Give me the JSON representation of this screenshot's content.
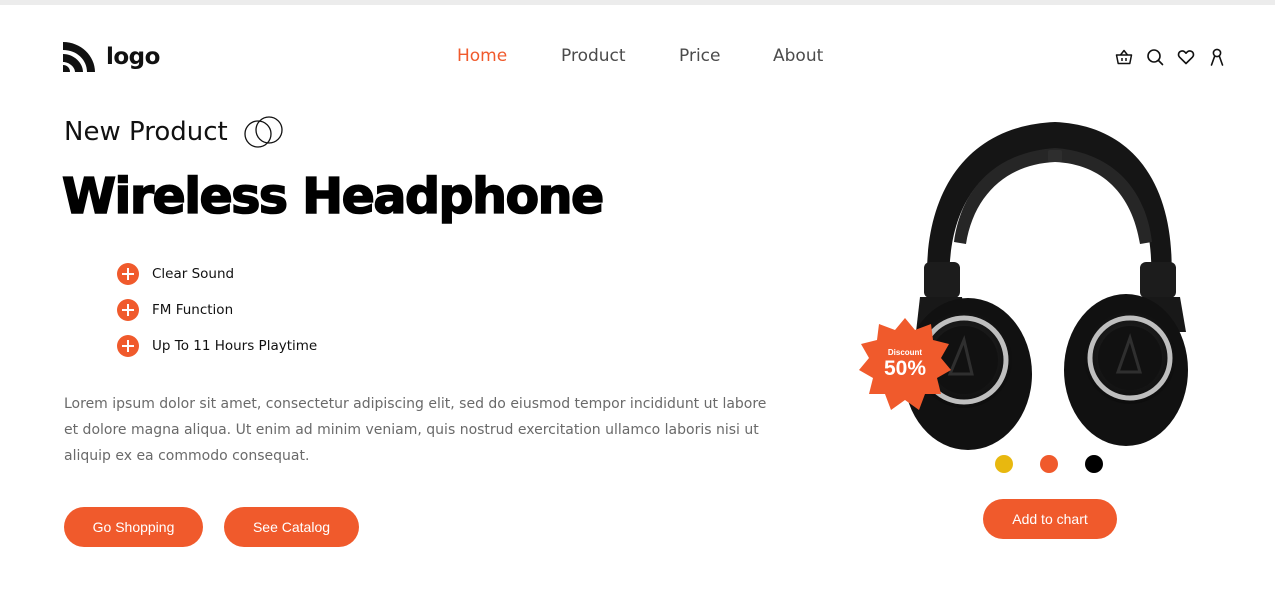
{
  "brand": {
    "logo_text": "logo"
  },
  "nav": {
    "items": [
      {
        "label": "Home",
        "active": true
      },
      {
        "label": "Product",
        "active": false
      },
      {
        "label": "Price",
        "active": false
      },
      {
        "label": "About",
        "active": false
      }
    ]
  },
  "header_icons": [
    "basket-icon",
    "search-icon",
    "heart-icon",
    "user-icon"
  ],
  "hero": {
    "eyebrow": "New Product",
    "title": "Wireless Headphone",
    "features": [
      "Clear Sound",
      "FM Function",
      "Up To 11 Hours Playtime"
    ],
    "description": "Lorem ipsum dolor sit amet, consectetur adipiscing elit, sed do eiusmod tempor incididunt ut labore et dolore magna aliqua. Ut enim ad minim veniam, quis nostrud exercitation ullamco laboris nisi ut aliquip ex ea commodo consequat.",
    "buttons": {
      "shop": "Go Shopping",
      "catalog": "See Catalog"
    }
  },
  "product": {
    "badge": {
      "label": "Discount",
      "value": "50%"
    },
    "colors": [
      "#e8b80f",
      "#f05a2c",
      "#000000"
    ],
    "cart_button": "Add to chart"
  },
  "theme": {
    "accent": "#f05a2c",
    "text": "#111111",
    "muted": "#6a6a6a"
  }
}
